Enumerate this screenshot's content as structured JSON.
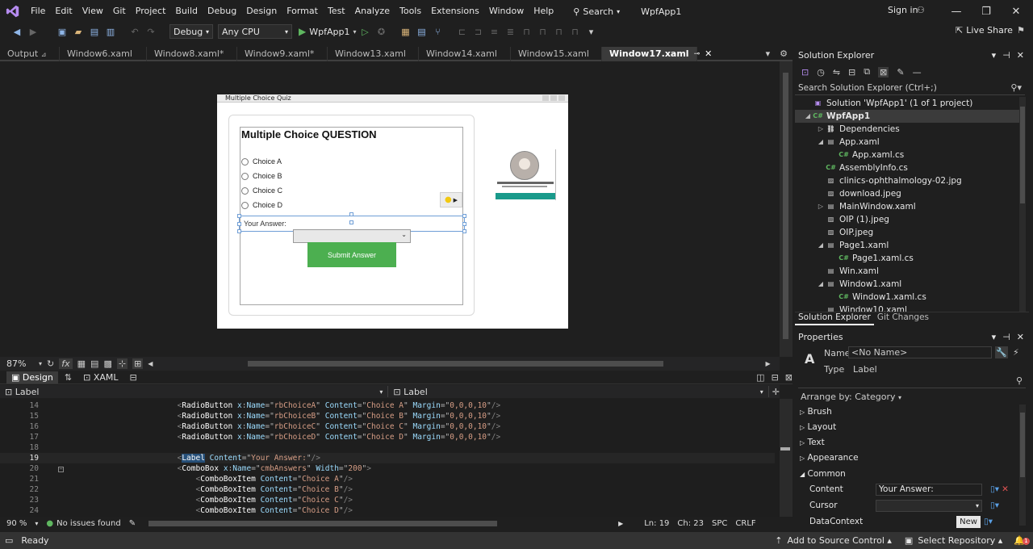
{
  "menubar": {
    "items": [
      "File",
      "Edit",
      "View",
      "Git",
      "Project",
      "Build",
      "Debug",
      "Design",
      "Format",
      "Test",
      "Analyze",
      "Tools",
      "Extensions",
      "Window",
      "Help"
    ],
    "search_label": "Search",
    "app_name": "WpfApp1",
    "sign_in": "Sign in",
    "live_share": "Live Share"
  },
  "toolbar": {
    "config": "Debug",
    "platform": "Any CPU",
    "run_target": "WpfApp1"
  },
  "tabs": [
    {
      "label": "Output",
      "pin": "⊿"
    },
    {
      "label": "Window6.xaml"
    },
    {
      "label": "Window8.xaml*"
    },
    {
      "label": "Window9.xaml*"
    },
    {
      "label": "Window13.xaml"
    },
    {
      "label": "Window14.xaml"
    },
    {
      "label": "Window15.xaml"
    },
    {
      "label": "Window17.xaml"
    }
  ],
  "preview": {
    "window_title": "Multiple Choice Quiz",
    "question": "Multiple Choice QUESTION",
    "choices": [
      "Choice A",
      "Choice B",
      "Choice C",
      "Choice D"
    ],
    "answer_label": "Your Answer:",
    "submit": "Submit Answer"
  },
  "zoom": {
    "value": "87%",
    "fx": "fx"
  },
  "modes": {
    "design": "Design",
    "xaml": "XAML"
  },
  "scope": {
    "left": "Label",
    "right": "Label"
  },
  "code": [
    {
      "n": "14",
      "indent": "            ",
      "tag": "RadioButton",
      "name": "rbChoiceA",
      "content": "Choice A",
      "margin": "0,0,0,10"
    },
    {
      "n": "15",
      "indent": "            ",
      "tag": "RadioButton",
      "name": "rbChoiceB",
      "content": "Choice B",
      "margin": "0,0,0,10"
    },
    {
      "n": "16",
      "indent": "            ",
      "tag": "RadioButton",
      "name": "rbChoiceC",
      "content": "Choice C",
      "margin": "0,0,0,10"
    },
    {
      "n": "17",
      "indent": "            ",
      "tag": "RadioButton",
      "name": "rbChoiceD",
      "content": "Choice D",
      "margin": "0,0,0,10"
    }
  ],
  "code_extra": {
    "l18": "18",
    "l19": "19",
    "label_tag": "Label",
    "label_attr": "Content",
    "label_val": "Your Answer:",
    "l20": "20",
    "combo_tag": "ComboBox",
    "combo_name": "cmbAnswers",
    "combo_width": "200",
    "items": [
      {
        "n": "21",
        "val": "Choice A"
      },
      {
        "n": "22",
        "val": "Choice B"
      },
      {
        "n": "23",
        "val": "Choice C"
      },
      {
        "n": "24",
        "val": "Choice D"
      }
    ]
  },
  "editor_status": {
    "zoom": "90 %",
    "issues": "No issues found",
    "ln": "Ln: 19",
    "ch": "Ch: 23",
    "spc": "SPC",
    "crlf": "CRLF"
  },
  "solution_explorer": {
    "title": "Solution Explorer",
    "search_placeholder": "Search Solution Explorer (Ctrl+;)",
    "items": [
      {
        "label": "Solution 'WpfApp1' (1 of 1 project)",
        "level": 0,
        "icon": "solution"
      },
      {
        "label": "WpfApp1",
        "level": 0,
        "icon": "project",
        "bold": true,
        "selected": true,
        "exp": "◢"
      },
      {
        "label": "Dependencies",
        "level": 1,
        "icon": "deps",
        "exp": "▷"
      },
      {
        "label": "App.xaml",
        "level": 1,
        "icon": "xaml",
        "exp": "◢"
      },
      {
        "label": "App.xaml.cs",
        "level": 2,
        "icon": "cs"
      },
      {
        "label": "AssemblyInfo.cs",
        "level": 1,
        "icon": "cs"
      },
      {
        "label": "clinics-ophthalmology-02.jpg",
        "level": 1,
        "icon": "img"
      },
      {
        "label": "download.jpeg",
        "level": 1,
        "icon": "img"
      },
      {
        "label": "MainWindow.xaml",
        "level": 1,
        "icon": "xaml",
        "exp": "▷"
      },
      {
        "label": "OIP (1).jpeg",
        "level": 1,
        "icon": "img"
      },
      {
        "label": "OIP.jpeg",
        "level": 1,
        "icon": "img"
      },
      {
        "label": "Page1.xaml",
        "level": 1,
        "icon": "xaml",
        "exp": "◢"
      },
      {
        "label": "Page1.xaml.cs",
        "level": 2,
        "icon": "cs"
      },
      {
        "label": "Win.xaml",
        "level": 1,
        "icon": "xaml"
      },
      {
        "label": "Window1.xaml",
        "level": 1,
        "icon": "xaml",
        "exp": "◢"
      },
      {
        "label": "Window1.xaml.cs",
        "level": 2,
        "icon": "cs"
      },
      {
        "label": "Window10.xaml",
        "level": 1,
        "icon": "xaml"
      }
    ],
    "bottom_tabs": [
      "Solution Explorer",
      "Git Changes"
    ]
  },
  "properties": {
    "title": "Properties",
    "name_label": "Name",
    "name_value": "<No Name>",
    "type_label": "Type",
    "type_value": "Label",
    "arrange": "Arrange by: Category",
    "categories": [
      "Brush",
      "Layout",
      "Text",
      "Appearance",
      "Common"
    ],
    "common": [
      {
        "label": "Content",
        "value": "Your Answer:"
      },
      {
        "label": "Cursor",
        "value": ""
      },
      {
        "label": "DataContext",
        "value": "New"
      }
    ]
  },
  "statusbar": {
    "ready": "Ready",
    "source_control": "Add to Source Control",
    "repo": "Select Repository",
    "notif_count": "1"
  },
  "colors": {
    "accent": "#4caf50",
    "vs_purple": "#7e57c2"
  }
}
